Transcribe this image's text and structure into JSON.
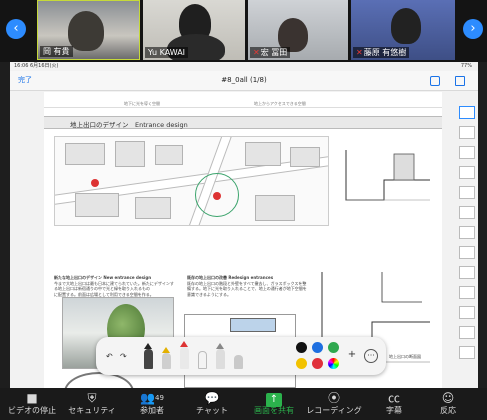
{
  "participants": [
    {
      "name": "岡 有貴",
      "muted": false
    },
    {
      "name": "Yu KAWAI",
      "muted": false
    },
    {
      "name": "宏 冨田",
      "muted": true
    },
    {
      "name": "藤原 有悠樹",
      "muted": true
    }
  ],
  "ipad": {
    "status_time": "16:06  6月16日(火)",
    "battery": "77%",
    "done_label": "完了",
    "doc_title": "#8_0all  (1/8)",
    "section_header": "地上出口のデザイン　Entrance design",
    "top_captions": [
      "地下に光を導く空間",
      "地上からアクセスできる空間"
    ],
    "text_left": [
      "新たな地上出口のデザイン New entrance design",
      "今まで大地上出口は最も日本に建てられていた。新たにデザインする地上出口は新宿通りの中で光と緑を取り入れるもの",
      "に配置する。前面は広場として利用できる空間を作る。"
    ],
    "text_mid": [
      "既存の地上出口の改善 Redesign entrances",
      "既存の地上出口の階段と外壁をすべて撤去し、ガラスボックスを整備する。地下に光を取り入れることで、地上の通行者が地下空間を",
      "意識できるようにする。"
    ],
    "text_right": "地上出口の断面図"
  },
  "palette": {
    "colors": [
      "#111111",
      "#1e6fe0",
      "#2fa84f",
      "#f2c200",
      "#e0303a"
    ]
  },
  "zoom_toolbar": {
    "buttons": [
      {
        "label": "ビデオの停止",
        "icon": "video-camera-icon"
      },
      {
        "label": "セキュリティ",
        "icon": "shield-icon"
      },
      {
        "label": "参加者",
        "icon": "participants-icon",
        "count": "49"
      },
      {
        "label": "チャット",
        "icon": "chat-icon"
      },
      {
        "label": "画面を共有",
        "icon": "share-screen-icon"
      },
      {
        "label": "レコーディング",
        "icon": "record-icon"
      },
      {
        "label": "字幕",
        "icon": "cc-icon"
      },
      {
        "label": "反応",
        "icon": "reaction-icon"
      }
    ]
  }
}
